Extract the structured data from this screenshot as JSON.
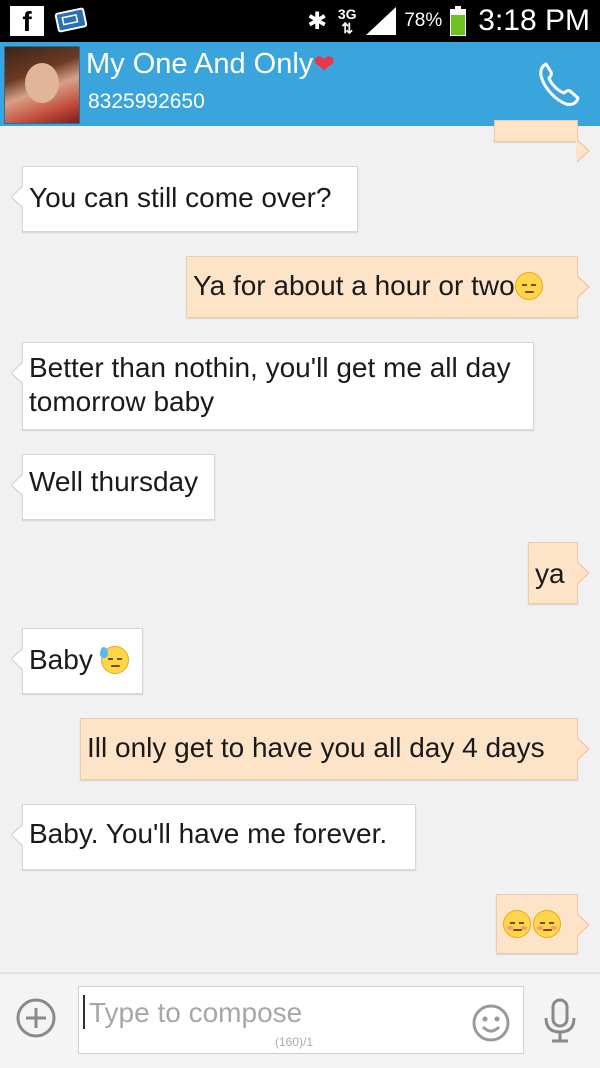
{
  "status_bar": {
    "app_icons": [
      "facebook-icon",
      "ticket-icon"
    ],
    "network": "3G",
    "battery": "78%",
    "time": "3:18 PM"
  },
  "header": {
    "contact_name": "My One And Only",
    "contact_number": "8325992650",
    "heart": "❤"
  },
  "messages": [
    {
      "direction": "in",
      "text": "You can still come over?",
      "emoji": ""
    },
    {
      "direction": "out",
      "text": "Ya for about a hour or two",
      "emoji": "pensive-face"
    },
    {
      "direction": "in",
      "text": "Better than nothin, you'll get me all day tomorrow baby",
      "emoji": ""
    },
    {
      "direction": "in",
      "text": "Well thursday",
      "emoji": ""
    },
    {
      "direction": "out",
      "text": "ya",
      "emoji": ""
    },
    {
      "direction": "in",
      "text": "Baby",
      "emoji": "sweat-face"
    },
    {
      "direction": "out",
      "text": "Ill only get to have you all day 4 days",
      "emoji": ""
    },
    {
      "direction": "in",
      "text": "Baby. You'll have me forever.",
      "emoji": ""
    },
    {
      "direction": "out",
      "text": "",
      "emoji": "relieved-face relieved-face"
    }
  ],
  "compose": {
    "placeholder": "Type to compose",
    "counter": "(160)/1"
  },
  "colors": {
    "header_bg": "#3aa5dc",
    "incoming_bubble": "#ffffff",
    "outgoing_bubble": "#fde3c8"
  }
}
